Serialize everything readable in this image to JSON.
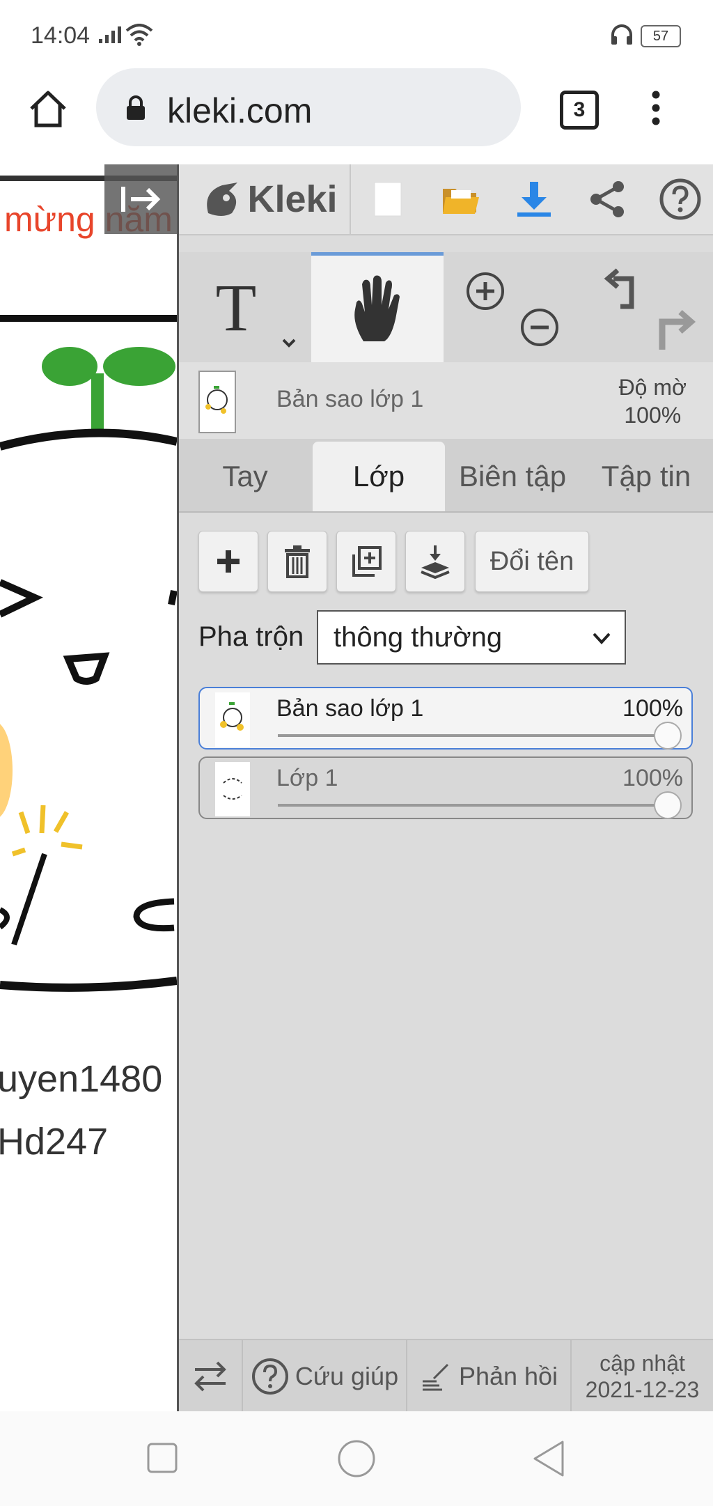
{
  "status_bar": {
    "time": "14:04",
    "battery": "57"
  },
  "browser": {
    "url": "kleki.com",
    "tab_count": "3"
  },
  "canvas": {
    "red_text": "mừng năm",
    "username_line1": "uyen1480",
    "username_line2": "Hd247"
  },
  "kleki": {
    "logo": "Kleki",
    "current_layer": {
      "name": "Bản sao lớp 1",
      "opacity_label": "Độ mờ",
      "opacity_value": "100%"
    },
    "tabs": [
      "Tay",
      "Lớp",
      "Biên tập",
      "Tập tin"
    ],
    "active_tab": "Lớp",
    "rename_button": "Đổi tên",
    "blend_label": "Pha trộn",
    "blend_value": "thông thường",
    "layers": [
      {
        "name": "Bản sao lớp 1",
        "opacity": "100%",
        "selected": true
      },
      {
        "name": "Lớp 1",
        "opacity": "100%",
        "selected": false
      }
    ],
    "footer": {
      "help": "Cứu giúp",
      "feedback": "Phản hồi",
      "update_label": "cập nhật",
      "update_date": "2021-12-23"
    }
  },
  "colors": {
    "accent": "#4a7fd8",
    "download": "#2a86e6",
    "folder": "#f0b429",
    "sprout": "#3aa335"
  }
}
